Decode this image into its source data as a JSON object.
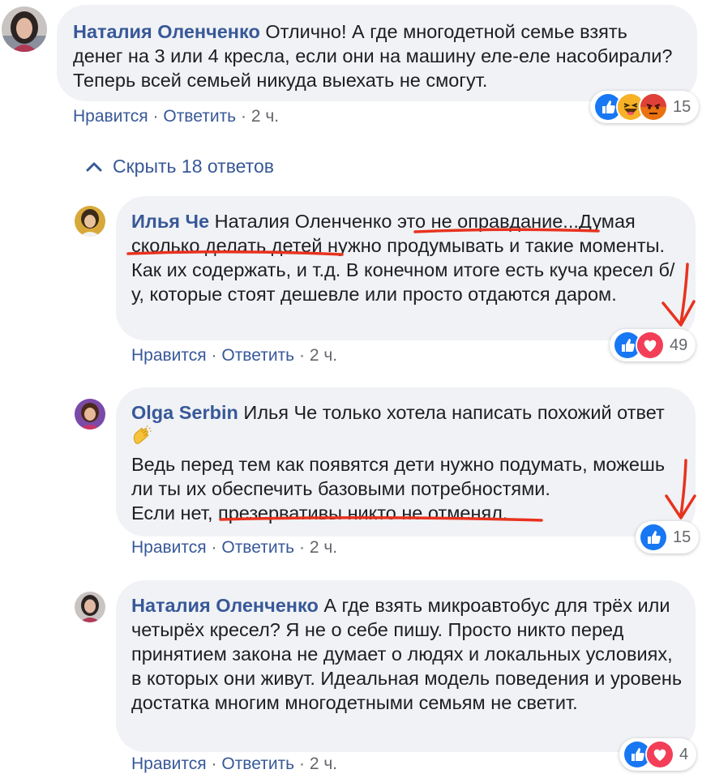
{
  "comments": [
    {
      "author": "Наталия Оленченко",
      "text": "Отлично! А где многодетной семье взять денег на 3 или 4 кресла, если они на машину еле-еле насобирали? Теперь всей семьей никуда выехать не смогут.",
      "like_label": "Нравится",
      "reply_label": "Ответить",
      "time": "2 ч.",
      "reaction_count": "15",
      "reactions": [
        "like-icon",
        "haha-icon",
        "angry-icon"
      ]
    },
    {
      "author": "Илья Че",
      "mention": "Наталия Оленченко",
      "text_parts": [
        "это не оправдание",
        "...Думая ",
        "сколько делать детей",
        " нужно продумывать и такие моменты. Как их содержать, и т.д. В конечном итоге есть куча кресел б/у, которые стоят дешевле или просто отдаются даром."
      ],
      "like_label": "Нравится",
      "reply_label": "Ответить",
      "time": "2 ч.",
      "reaction_count": "49",
      "reactions": [
        "like-icon",
        "love-icon"
      ]
    },
    {
      "author": "Olga Serbin",
      "mention": "Илья Че",
      "line1": "только хотела написать похожий ответ",
      "emoji": "clapping-hands-icon",
      "line2": "Ведь перед тем как появятся дети нужно подумать, можешь ли ты их обеспечить базовыми потребностями.",
      "line3_prefix": "Если нет, ",
      "line3_marked": "презервативы никто не отменял",
      "line3_suffix": ".",
      "like_label": "Нравится",
      "reply_label": "Ответить",
      "time": "2 ч.",
      "reaction_count": "15",
      "reactions": [
        "like-icon"
      ]
    },
    {
      "author": "Наталия Оленченко",
      "text": "А где взять микроавтобус для трёх или четырёх кресел? Я не о себе пишу. Просто никто перед принятием закона не думает о людях и локальных условиях, в которых они живут. Идеальная модель поведения и уровень достатка многим многодетными семьям не светит.",
      "like_label": "Нравится",
      "reply_label": "Ответить",
      "time": "2 ч.",
      "reaction_count": "4",
      "reactions": [
        "like-icon",
        "love-icon"
      ]
    }
  ],
  "toggle_replies": "Скрыть 18 ответов",
  "separator": "·",
  "colors": {
    "link": "#385898",
    "bubble": "#f0f2f5",
    "annotation": "#e8321e",
    "like": "#1877f2",
    "love": "#f33e58"
  }
}
